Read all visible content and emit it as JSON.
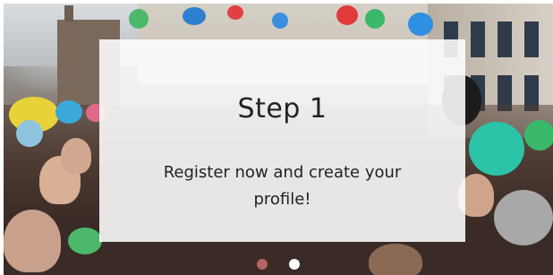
{
  "slide": {
    "title": "Step 1",
    "text": "Register now and create your profile!",
    "total_slides": 2,
    "active_index": 1
  },
  "colors": {
    "overlay": "#ffffff",
    "text": "#222222",
    "dot_active": "#ffffff",
    "dot_inactive": "#dc7878"
  }
}
